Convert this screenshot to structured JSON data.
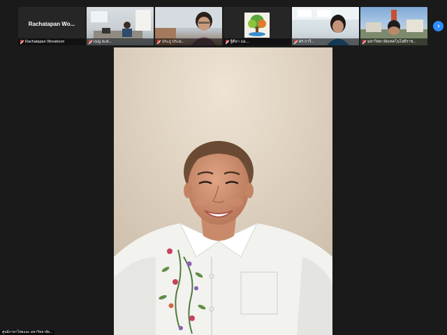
{
  "top_strip": {
    "tiles": [
      {
        "name": "Rachatapan Wo...",
        "label": "Rachatapan Woraboon",
        "video": false
      },
      {
        "name": "",
        "label": "เบญ ละห...",
        "video": true
      },
      {
        "name": "",
        "label": "ประภู ประม...",
        "video": true
      },
      {
        "name": "",
        "label": "ฐิติยา แม...",
        "video": true
      },
      {
        "name": "",
        "label": "ศร กาวิ...",
        "video": true
      },
      {
        "name": "",
        "label": "มหาวิทยาลัยเทคโนโลยีราช...",
        "video": true
      }
    ],
    "next_icon": "chevron-right-icon"
  },
  "main_video": {
    "speaker_label": "ศูนย์ภาษาไทยและ มหาวิทยาลัย..."
  },
  "colors": {
    "background": "#1a1a1a",
    "accent": "#2d8cff",
    "muted": "#e04040"
  }
}
